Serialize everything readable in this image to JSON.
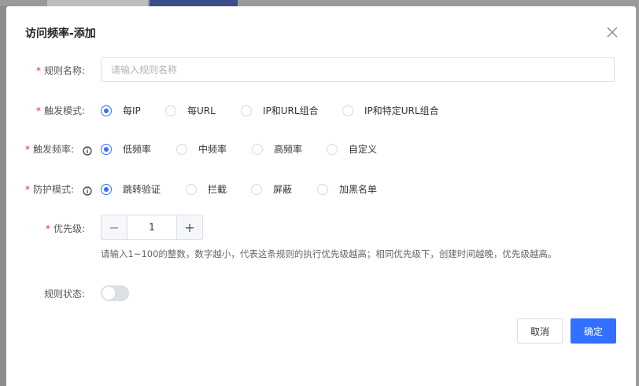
{
  "dialog": {
    "title": "访问频率-添加",
    "close_icon": "close-icon"
  },
  "form": {
    "rule_name": {
      "label": "规则名称:",
      "required": "*",
      "value": "",
      "placeholder": "请输入规则名称"
    },
    "trigger_mode": {
      "label": "触发模式:",
      "required": "*",
      "options": [
        "每IP",
        "每URL",
        "IP和URL组合",
        "IP和特定URL组合"
      ],
      "selected": "每IP"
    },
    "trigger_frequency": {
      "label": "触发频率:",
      "required": "*",
      "info_icon": "info-icon",
      "options": [
        "低频率",
        "中频率",
        "高频率",
        "自定义"
      ],
      "selected": "低频率"
    },
    "protection_mode": {
      "label": "防护模式:",
      "required": "*",
      "info_icon": "info-icon",
      "options": [
        "跳转验证",
        "拦截",
        "屏蔽",
        "加黑名单"
      ],
      "selected": "跳转验证"
    },
    "priority": {
      "label": "优先级:",
      "required": "*",
      "value": "1",
      "minus": "−",
      "plus": "+",
      "hint": "请输入1~100的整数，数字越小，代表这条规则的执行优先级越高；相同优先级下，创建时间越晚，优先级越高。"
    },
    "rule_status": {
      "label": "规则状态:",
      "enabled": false
    }
  },
  "footer": {
    "cancel_label": "取消",
    "confirm_label": "确定"
  },
  "colors": {
    "primary": "#3370ff",
    "required": "#f5222d"
  }
}
